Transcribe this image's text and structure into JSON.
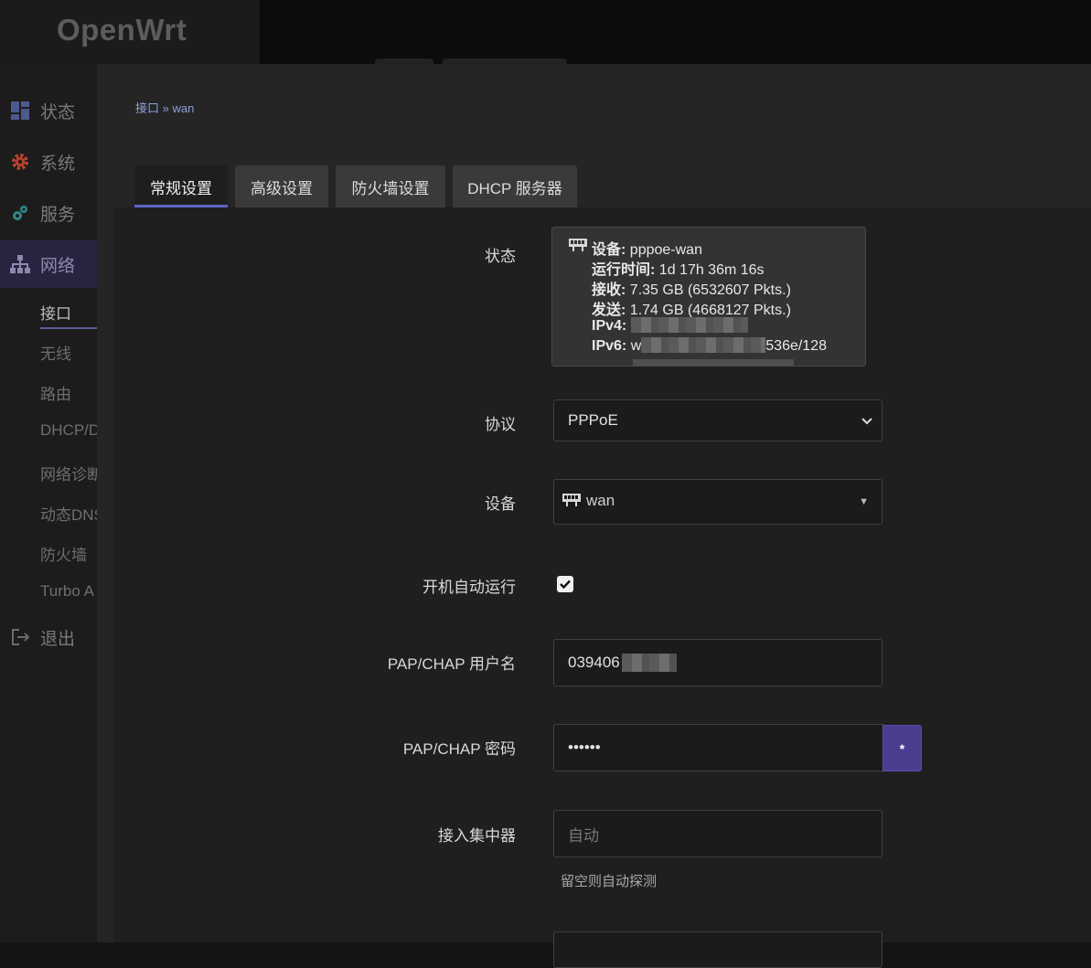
{
  "app": {
    "logo": "OpenWrt"
  },
  "sidebar": {
    "items": [
      {
        "label": "状态",
        "icon": "dashboard-icon"
      },
      {
        "label": "系统",
        "icon": "gear-icon"
      },
      {
        "label": "服务",
        "icon": "puzzle-icon"
      },
      {
        "label": "网络",
        "icon": "network-tree-icon",
        "active": true
      },
      {
        "label": "退出",
        "icon": "logout-icon"
      }
    ],
    "network_sub": [
      "接口",
      "无线",
      "路由",
      "DHCP/D",
      "网络诊断",
      "动态DNS",
      "防火墙",
      "Turbo A"
    ]
  },
  "breadcrumb": "接口 » wan",
  "tabs": [
    "常规设置",
    "高级设置",
    "防火墙设置",
    "DHCP 服务器"
  ],
  "form": {
    "status": {
      "label": "状态",
      "device_label": "设备:",
      "device_value": "pppoe-wan",
      "uptime_label": "运行时间:",
      "uptime_value": "1d 17h 36m 16s",
      "rx_label": "接收:",
      "rx_value": "7.35 GB (6532607 Pkts.)",
      "tx_label": "发送:",
      "tx_value": "1.74 GB (4668127 Pkts.)",
      "ipv4_label": "IPv4:",
      "ipv6_label": "IPv6:",
      "ipv6_prefix": "w",
      "ipv6_suffix": "536e/128"
    },
    "protocol": {
      "label": "协议",
      "value": "PPPoE"
    },
    "device": {
      "label": "设备",
      "value": "wan"
    },
    "autostart": {
      "label": "开机自动运行",
      "checked": true
    },
    "username": {
      "label": "PAP/CHAP 用户名",
      "value": "039406"
    },
    "password": {
      "label": "PAP/CHAP 密码",
      "value": "••••••",
      "reveal": "*"
    },
    "concentrator": {
      "label": "接入集中器",
      "placeholder": "自动",
      "hint": "留空则自动探测"
    }
  },
  "colors": {
    "accent": "#5d63c6",
    "button": "#4d3d91",
    "link": "#8ea0d8"
  }
}
